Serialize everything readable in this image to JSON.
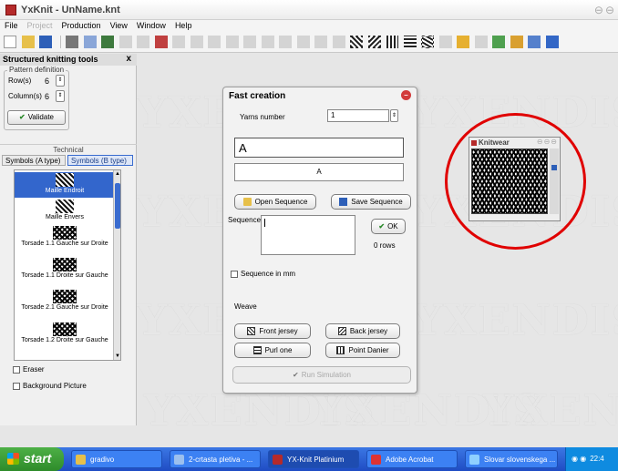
{
  "window": {
    "title": "YxKnit - UnName.knt"
  },
  "menu": {
    "items": [
      "File",
      "Project",
      "Production",
      "View",
      "Window",
      "Help"
    ]
  },
  "left_panel": {
    "title": "Structured knitting tools",
    "close": "x",
    "pattern_definition": {
      "legend": "Pattern definition",
      "rows_label": "Row(s)",
      "rows_value": "6",
      "columns_label": "Column(s)",
      "columns_value": "6",
      "validate_label": "Validate"
    },
    "technical_label": "Technical",
    "tabs": [
      "Symbols (A type)",
      "Symbols (B type)"
    ],
    "symbols": [
      "Maille Endroit",
      "Maille Envers",
      "Torsade 1.1 Gauche sur Droite",
      "Torsade 1.1 Droite sur Gauche",
      "Torsade 2.1 Gauche sur Droite",
      "Torsade 1.2 Droite sur Gauche"
    ],
    "eraser_label": "Eraser",
    "background_label": "Background Picture"
  },
  "watermark": "YXENDIS",
  "fast_creation": {
    "title": "Fast creation",
    "yarns_label": "Yarns number",
    "yarns_value": "1",
    "input_value": "A",
    "preview_value": "A",
    "open_sequence": "Open Sequence",
    "save_sequence": "Save Sequence",
    "sequence_label": "Sequence",
    "ok_label": "OK",
    "rows_label": "0 rows",
    "sequence_mm_label": "Sequence in mm",
    "weave_label": "Weave",
    "front_jersey": "Front jersey",
    "back_jersey": "Back jersey",
    "purl_one": "Purl one",
    "point_danier": "Point Danier",
    "run_simulation": "Run Simulation"
  },
  "knitwear": {
    "title": "Knitwear"
  },
  "taskbar": {
    "start": "start",
    "tasks": [
      "gradivo",
      "2-crtasta pletiva - ...",
      "YX-Knit Platinium",
      "Adobe Acrobat",
      "Slovar slovenskega ..."
    ],
    "clock": "22:4"
  },
  "colors": {
    "accent": "#3366cc",
    "highlight_circle": "#e00000",
    "taskbar": "#245edb"
  }
}
